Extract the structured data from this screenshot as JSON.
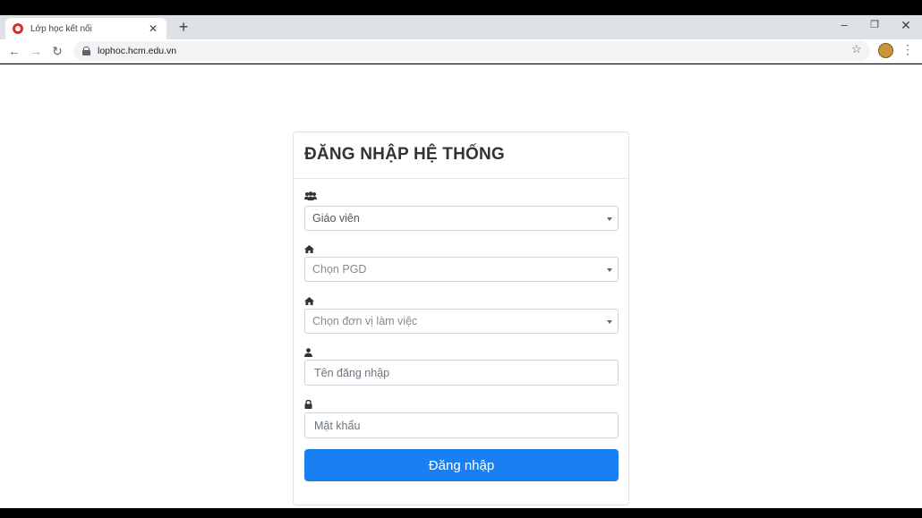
{
  "browser": {
    "tab_title": "Lớp học kết nối",
    "url": "lophoc.hcm.edu.vn",
    "new_tab_glyph": "+",
    "close_tab_glyph": "✕"
  },
  "login": {
    "title": "ĐĂNG NHẬP HỆ THỐNG",
    "role_select": {
      "icon": "users-icon",
      "value": "Giáo viên"
    },
    "district_select": {
      "icon": "home-icon",
      "placeholder": "Chọn PGD"
    },
    "unit_select": {
      "icon": "home-icon",
      "placeholder": "Chọn đơn vị làm việc"
    },
    "username": {
      "icon": "user-icon",
      "placeholder": "Tên đăng nhập"
    },
    "password": {
      "icon": "lock-icon",
      "placeholder": "Mật khẩu"
    },
    "submit_label": "Đăng nhập"
  },
  "colors": {
    "primary": "#1a80f2",
    "tabstrip": "#dee1e6",
    "favicon": "#d93025"
  }
}
